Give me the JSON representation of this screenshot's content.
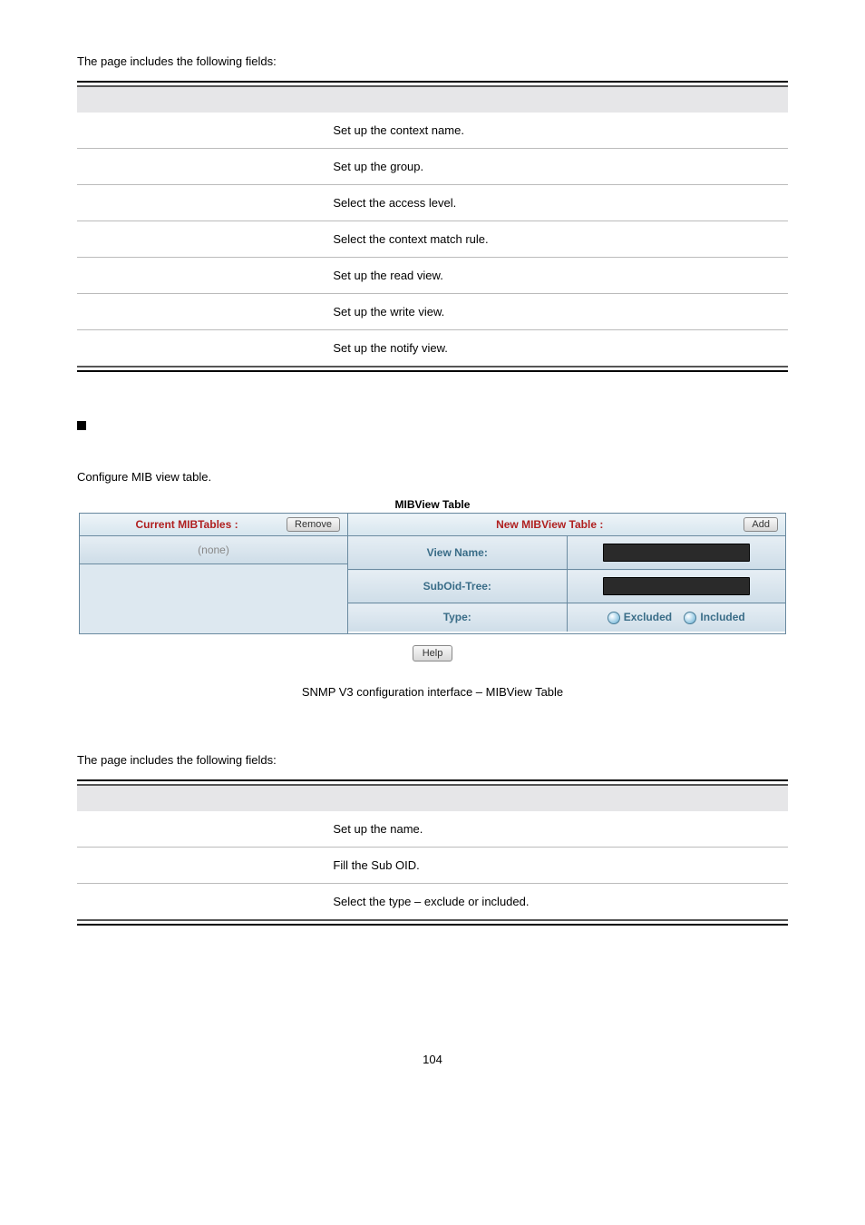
{
  "intro1": "The page includes the following fields:",
  "access_table_rows": [
    "Set up the context name.",
    "Set up the group.",
    "Select the access level.",
    "Select the context match rule.",
    "Set up the read view.",
    "Set up the write view.",
    "Set up the notify view."
  ],
  "mibview_heading_text": "",
  "mibview_desc": "Configure MIB view table.",
  "mib_panel": {
    "title": "MIBView Table",
    "left_header": "Current MIBTables :",
    "remove_btn": "Remove",
    "right_header": "New MIBView Table :",
    "add_btn": "Add",
    "left_none": "(none)",
    "rows": {
      "view_name": "View Name:",
      "suboid": "SubOid-Tree:",
      "type": "Type:",
      "excluded": "Excluded",
      "included": "Included"
    },
    "help_btn": "Help"
  },
  "caption": "SNMP V3 configuration interface – MIBView Table",
  "intro2": "The page includes the following fields:",
  "mibview_table_rows": [
    "Set up the name.",
    "Fill the Sub OID.",
    "Select the type – exclude or included."
  ],
  "page_number": "104"
}
